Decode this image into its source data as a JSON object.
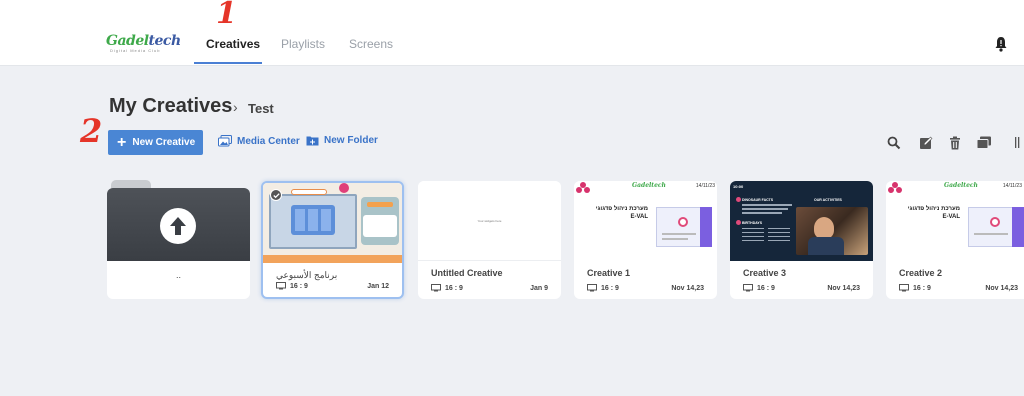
{
  "header": {
    "logo": {
      "brand_a": "Gadel",
      "brand_b": "tech",
      "tagline": "Digital Media Club"
    },
    "tabs": [
      {
        "label": "Creatives"
      },
      {
        "label": "Playlists"
      },
      {
        "label": "Screens"
      }
    ]
  },
  "annotations": {
    "one": "1",
    "two": "2"
  },
  "breadcrumb": {
    "title": "My Creatives",
    "separator": "›",
    "current": "Test"
  },
  "toolbar": {
    "new_creative": "New Creative",
    "media_center": "Media Center",
    "new_folder": "New Folder"
  },
  "folder": {
    "label": ".."
  },
  "creatives": [
    {
      "name": "برنامج الأسبوعي",
      "ratio": "16 : 9",
      "date": "Jan 12"
    },
    {
      "name": "Untitled Creative",
      "ratio": "16 : 9",
      "date": "Jan 9",
      "thumb_text": "Your widgets here"
    },
    {
      "name": "Creative 1",
      "ratio": "16 : 9",
      "date": "Nov 14,23",
      "thumb_date": "14/11/23",
      "thumb_brand": "Gadeltech",
      "thumb_title": "מערכת ניהול פדגוגי",
      "thumb_title2": "E-VAL"
    },
    {
      "name": "Creative 3",
      "ratio": "16 : 9",
      "date": "Nov 14,23",
      "thumb_time": "10:00",
      "thumb_heading": "DINOSAUR FACTS",
      "thumb_heading2": "OUR ACTIVITIES",
      "thumb_section": "BIRTHDAYS"
    },
    {
      "name": "Creative 2",
      "ratio": "16 : 9",
      "date": "Nov 14,23",
      "thumb_date": "14/11/23",
      "thumb_brand": "Gadeltech",
      "thumb_title": "מערכת ניהול פדגוגי",
      "thumb_title2": "E-VAL"
    }
  ],
  "colors": {
    "accent": "#4a86d4",
    "annotation": "#e53529",
    "brand_green": "#3ea94a"
  }
}
